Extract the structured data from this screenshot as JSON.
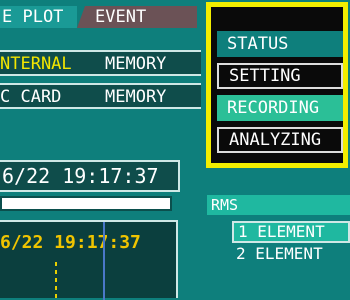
{
  "tabs": {
    "plot": "E PLOT",
    "event": "EVENT"
  },
  "memory": {
    "row1_a": "NTERNAL",
    "row1_b": "MEMORY",
    "row2_a": "C CARD",
    "row2_b": "MEMORY"
  },
  "datetime_top": "6/22 19:17:37",
  "datetime_graph": "6/22 19:17:37",
  "menu": {
    "status": "STATUS",
    "setting": "SETTING",
    "recording": "RECORDING",
    "analyzing": "ANALYZING"
  },
  "rms": {
    "label": "RMS",
    "element1": "1 ELEMENT",
    "element2": "2 ELEMENT"
  },
  "colors": {
    "background": "#0e7f7c",
    "highlight_frame": "#f2ee00",
    "recording_selected": "#2bbf97"
  }
}
